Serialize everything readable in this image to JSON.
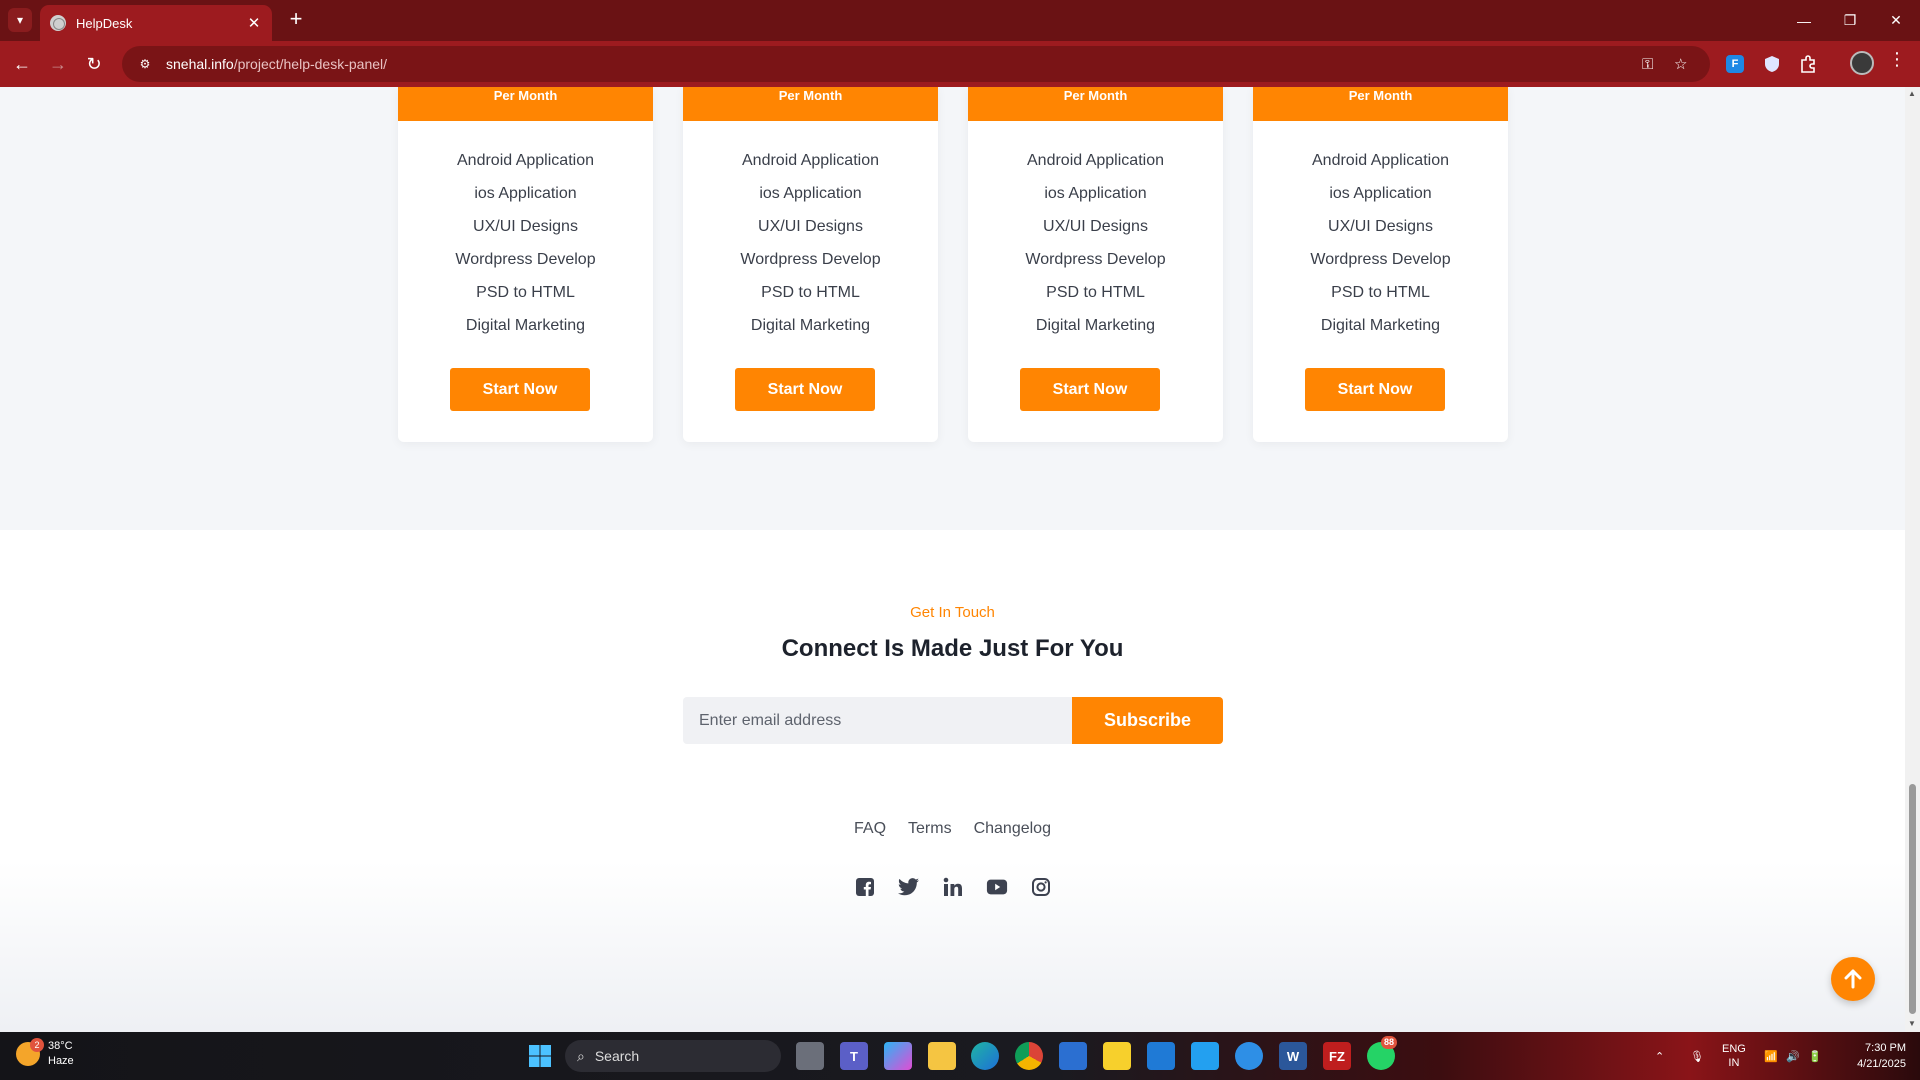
{
  "browser": {
    "tab_title": "HelpDesk",
    "url_host": "snehal.info",
    "url_path": "/project/help-desk-panel/",
    "ext_letter": "F"
  },
  "pricing": {
    "cards": [
      {
        "head": "Per Month",
        "features": [
          "Android Application",
          "ios Application",
          "UX/UI Designs",
          "Wordpress Develop",
          "PSD to HTML",
          "Digital Marketing"
        ],
        "cta": "Start Now"
      },
      {
        "head": "Per Month",
        "features": [
          "Android Application",
          "ios Application",
          "UX/UI Designs",
          "Wordpress Develop",
          "PSD to HTML",
          "Digital Marketing"
        ],
        "cta": "Start Now"
      },
      {
        "head": "Per Month",
        "features": [
          "Android Application",
          "ios Application",
          "UX/UI Designs",
          "Wordpress Develop",
          "PSD to HTML",
          "Digital Marketing"
        ],
        "cta": "Start Now"
      },
      {
        "head": "Per Month",
        "features": [
          "Android Application",
          "ios Application",
          "UX/UI Designs",
          "Wordpress Develop",
          "PSD to HTML",
          "Digital Marketing"
        ],
        "cta": "Start Now"
      }
    ]
  },
  "contact": {
    "eyebrow": "Get In Touch",
    "heading": "Connect Is Made Just For You",
    "email_placeholder": "Enter email address",
    "subscribe_label": "Subscribe"
  },
  "footer": {
    "links": [
      "FAQ",
      "Terms",
      "Changelog"
    ],
    "socials": [
      "facebook-icon",
      "twitter-icon",
      "linkedin-icon",
      "youtube-icon",
      "instagram-icon"
    ]
  },
  "taskbar": {
    "weather_temp": "38°C",
    "weather_desc": "Haze",
    "weather_badge": "2",
    "search_label": "Search",
    "whatsapp_badge": "88",
    "lang_line1": "ENG",
    "lang_line2": "IN",
    "time": "7:30 PM",
    "date": "4/21/2025"
  },
  "colors": {
    "accent": "#ff8502",
    "browser_frame": "#9d1b1f"
  }
}
